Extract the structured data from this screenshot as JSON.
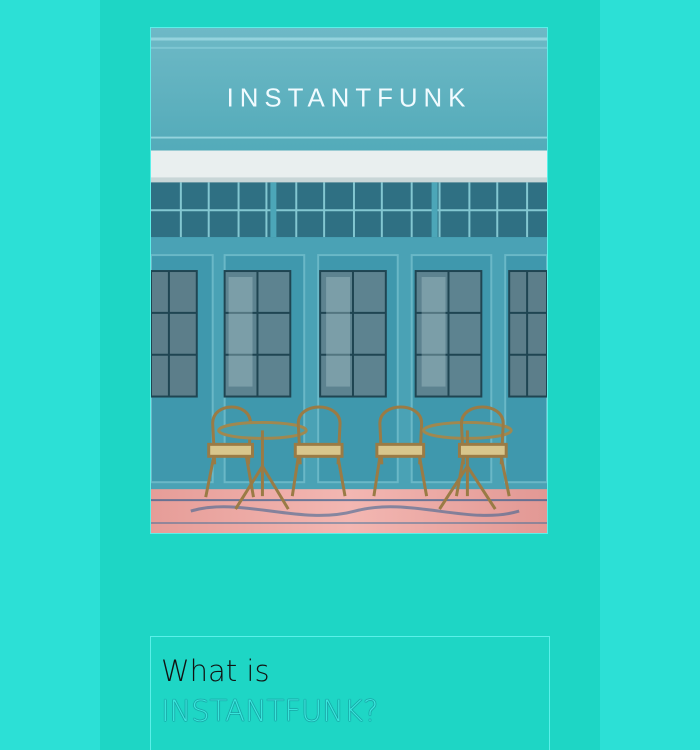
{
  "hero": {
    "sign_text": "INSTANTFUNK"
  },
  "intro_card": {
    "heading_prefix": "What is",
    "heading_brand": "INSTANTFUNK?"
  }
}
